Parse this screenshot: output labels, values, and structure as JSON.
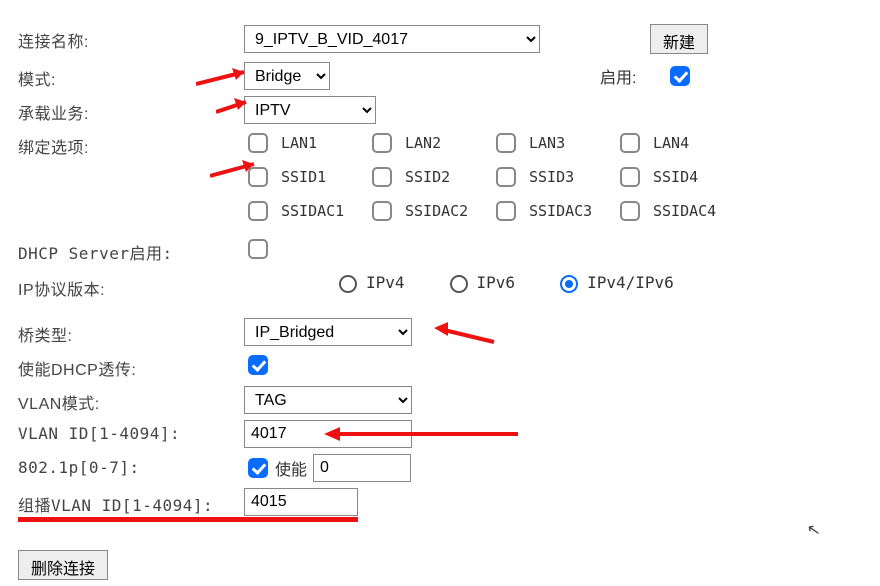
{
  "labels": {
    "conn_name": "连接名称:",
    "mode": "模式:",
    "service": "承载业务:",
    "binding": "绑定选项:",
    "dhcp_server": "DHCP Server启用:",
    "ip_version": "IP协议版本:",
    "bridge_type": "桥类型:",
    "dhcp_pt": "使能DHCP透传:",
    "vlan_mode": "VLAN模式:",
    "vlan_id": "VLAN ID[1-4094]:",
    "p8021": "802.1p[0-7]:",
    "mcast_vlan": "组播VLAN ID[1-4094]:",
    "enable": "启用:",
    "p_enable": "使能"
  },
  "values": {
    "conn_name": "9_IPTV_B_VID_4017",
    "mode": "Bridge",
    "service": "IPTV",
    "bridge_type": "IP_Bridged",
    "vlan_mode": "TAG",
    "vlan_id": "4017",
    "p_value": "0",
    "mcast_vlan": "4015"
  },
  "bindings": {
    "row1": [
      "LAN1",
      "LAN2",
      "LAN3",
      "LAN4"
    ],
    "row2": [
      "SSID1",
      "SSID2",
      "SSID3",
      "SSID4"
    ],
    "row3": [
      "SSIDAC1",
      "SSIDAC2",
      "SSIDAC3",
      "SSIDAC4"
    ]
  },
  "ip_versions": [
    "IPv4",
    "IPv6",
    "IPv4/IPv6"
  ],
  "buttons": {
    "new": "新建",
    "delete": "删除连接"
  },
  "state": {
    "enable": true,
    "dhcp_server": false,
    "dhcp_pt": true,
    "p_enable": true,
    "ip_version": "IPv4/IPv6"
  }
}
